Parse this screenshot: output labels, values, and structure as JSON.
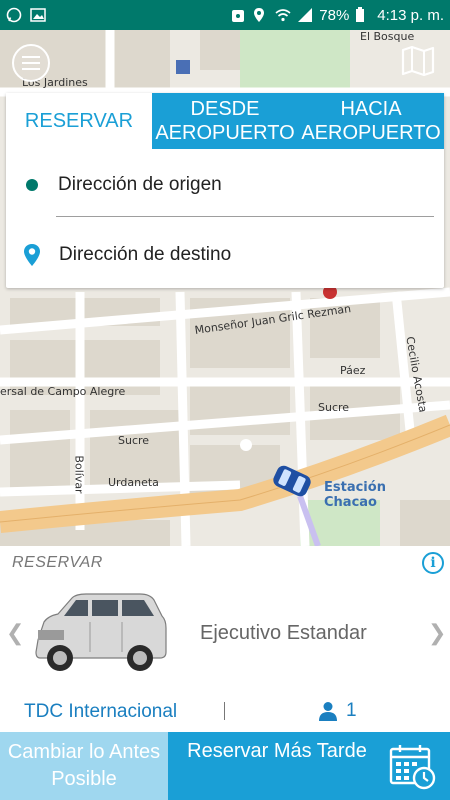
{
  "status_bar": {
    "battery": "78%",
    "time": "4:13 p. m."
  },
  "map": {
    "streets": [
      "Monseñor Juan Grilc Rezman",
      "Páez",
      "Sucre",
      "Sucre",
      "Urdaneta",
      "Bolívar",
      "Cecilio Acosta",
      "ersal de Campo Alegre",
      "Los Jardines",
      "El Bosque"
    ],
    "station": "Estación Chacao"
  },
  "booking": {
    "tabs": [
      {
        "label": "RESERVAR",
        "active": true
      },
      {
        "label": "DESDE AEROPUERTO",
        "active": false
      },
      {
        "label": "HACIA AEROPUERTO",
        "active": false
      }
    ],
    "origin_placeholder": "Dirección de origen",
    "destination_placeholder": "Dirección de destino"
  },
  "sheet": {
    "title": "RESERVAR",
    "vehicle": "Ejecutivo Estandar",
    "payment": "TDC Internacional",
    "passengers": "1"
  },
  "buttons": {
    "change": "Cambiar lo Antes Posible",
    "later": "Reservar Más Tarde"
  },
  "colors": {
    "status_bar": "#00796b",
    "accent": "#1a9fd6",
    "accent_light": "#9fd7ef"
  }
}
